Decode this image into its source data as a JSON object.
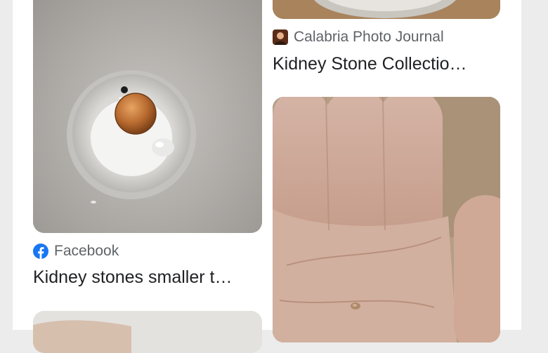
{
  "results": [
    {
      "source": "Calabria Photo Journal",
      "source_icon": "calabria-photo-journal-favicon",
      "title": "Kidney Stone Collectio…",
      "image": "kidney-stone-bowl-photo-partial"
    },
    {
      "source": "Facebook",
      "source_icon": "facebook-icon",
      "title": "Kidney stones smaller t…",
      "image": "penny-in-dish-photo"
    },
    {
      "image": "hand-palm-with-stone-photo"
    },
    {
      "image": "partial-photo-bottom-left"
    }
  ],
  "colors": {
    "facebook_blue": "#1877f2",
    "source_text": "#5f6368",
    "title_text": "#202124"
  }
}
